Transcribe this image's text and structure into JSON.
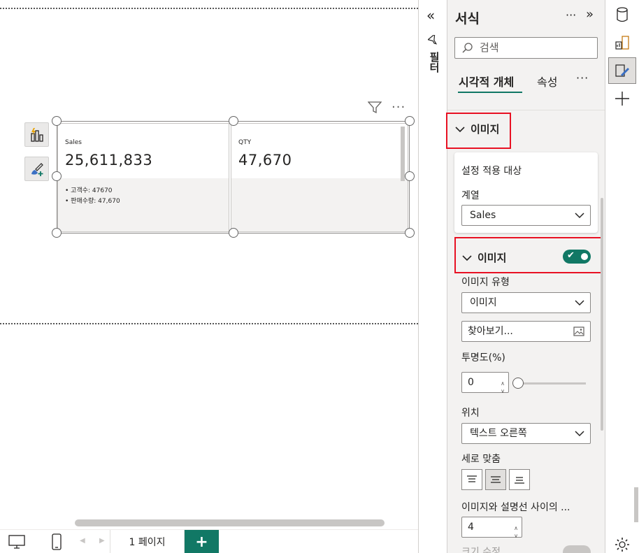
{
  "canvas": {
    "cards": [
      {
        "category": "Sales",
        "value": "25,611,833",
        "bullets": [
          "• 고객수: 47670",
          "• 판매수량: 47,670"
        ]
      },
      {
        "category": "QTY",
        "value": "47,670",
        "bullets": []
      }
    ],
    "visual_header": {
      "filter_icon": "filter-icon",
      "more": "···"
    }
  },
  "bottom_bar": {
    "page_tab": "1 페이지",
    "add_page": "+"
  },
  "filter_pane": {
    "label": "필터",
    "collapse": "«"
  },
  "format_pane": {
    "title": "서식",
    "more": "···",
    "collapse": "»",
    "search_placeholder": "검색",
    "tabs": [
      "시각적 개체",
      "속성"
    ],
    "tabs_more": "···",
    "section_image": "이미지",
    "apply_settings_to": "설정 적용 대상",
    "series_label": "계열",
    "series_value": "Sales",
    "image_toggle_label": "이미지",
    "image_toggle_on": true,
    "image_type_label": "이미지 유형",
    "image_type_value": "이미지",
    "browse": "찾아보기...",
    "transparency_label": "투명도(%)",
    "transparency_value": "0",
    "position_label": "위치",
    "position_value": "텍스트 오른쪽",
    "vertical_align_label": "세로 맞춤",
    "spacing_label": "이미지와 설명선 사이의 ...",
    "spacing_value": "4",
    "size_label": "크기 수정"
  },
  "colors": {
    "accent": "#117865",
    "highlight": "#e81123"
  }
}
